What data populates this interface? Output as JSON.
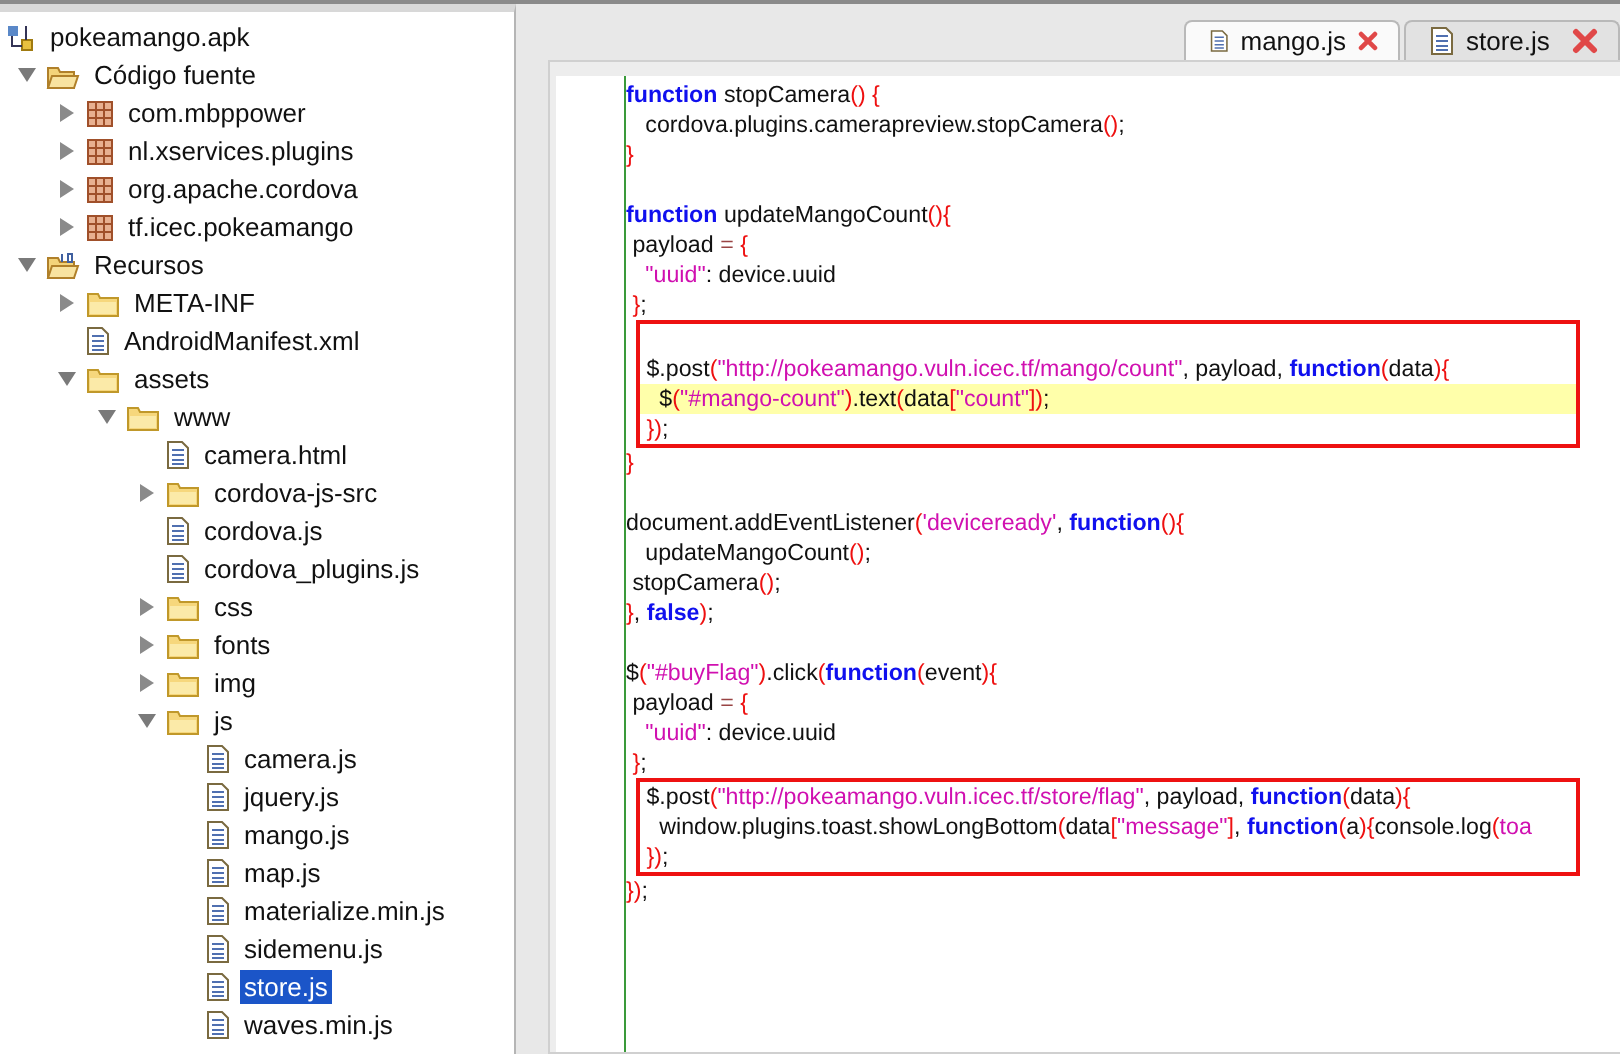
{
  "tree": [
    {
      "label": "pokeamango.apk",
      "kind": "apk",
      "children": [
        {
          "label": "Código fuente",
          "kind": "source-root",
          "expanded": true,
          "children": [
            {
              "label": "com.mbppower",
              "kind": "package",
              "expanded": false
            },
            {
              "label": "nl.xservices.plugins",
              "kind": "package",
              "expanded": false
            },
            {
              "label": "org.apache.cordova",
              "kind": "package",
              "expanded": false
            },
            {
              "label": "tf.icec.pokeamango",
              "kind": "package",
              "expanded": false
            }
          ]
        },
        {
          "label": "Recursos",
          "kind": "resource-root",
          "expanded": true,
          "children": [
            {
              "label": "META-INF",
              "kind": "folder",
              "expanded": false
            },
            {
              "label": "AndroidManifest.xml",
              "kind": "file",
              "selected": false
            },
            {
              "label": "assets",
              "kind": "folder",
              "expanded": true,
              "children": [
                {
                  "label": "www",
                  "kind": "folder",
                  "expanded": true,
                  "children": [
                    {
                      "label": "camera.html",
                      "kind": "file",
                      "selected": false
                    },
                    {
                      "label": "cordova-js-src",
                      "kind": "folder",
                      "expanded": false
                    },
                    {
                      "label": "cordova.js",
                      "kind": "file",
                      "selected": false
                    },
                    {
                      "label": "cordova_plugins.js",
                      "kind": "file",
                      "selected": false
                    },
                    {
                      "label": "css",
                      "kind": "folder",
                      "expanded": false
                    },
                    {
                      "label": "fonts",
                      "kind": "folder",
                      "expanded": false
                    },
                    {
                      "label": "img",
                      "kind": "folder",
                      "expanded": false
                    },
                    {
                      "label": "js",
                      "kind": "folder",
                      "expanded": true,
                      "children": [
                        {
                          "label": "camera.js",
                          "kind": "file",
                          "selected": false
                        },
                        {
                          "label": "jquery.js",
                          "kind": "file",
                          "selected": false
                        },
                        {
                          "label": "mango.js",
                          "kind": "file",
                          "selected": false
                        },
                        {
                          "label": "map.js",
                          "kind": "file",
                          "selected": false
                        },
                        {
                          "label": "materialize.min.js",
                          "kind": "file",
                          "selected": false
                        },
                        {
                          "label": "sidemenu.js",
                          "kind": "file",
                          "selected": false
                        },
                        {
                          "label": "store.js",
                          "kind": "file",
                          "selected": true
                        },
                        {
                          "label": "waves.min.js",
                          "kind": "file",
                          "selected": false
                        }
                      ]
                    }
                  ]
                }
              ]
            }
          ]
        }
      ]
    }
  ],
  "tabs": [
    {
      "label": "mango.js",
      "selected": true
    },
    {
      "label": "store.js",
      "selected": false
    }
  ],
  "code": [
    {
      "boxed": false,
      "lines": [
        {
          "kind": "code",
          "current": false,
          "tokens": [
            {
              "kind": "kw",
              "text": "function"
            },
            {
              "kind": "plain",
              "text": " stopCamera"
            },
            {
              "kind": "punct",
              "text": "() {"
            }
          ]
        },
        {
          "kind": "code",
          "current": false,
          "tokens": [
            {
              "kind": "plain",
              "text": "   cordova.plugins.camerapreview.stopCamera"
            },
            {
              "kind": "punct",
              "text": "()"
            },
            {
              "kind": "plain",
              "text": ";"
            }
          ]
        },
        {
          "kind": "code",
          "current": false,
          "tokens": [
            {
              "kind": "punct",
              "text": "}"
            }
          ]
        },
        {
          "kind": "blank"
        },
        {
          "kind": "code",
          "current": false,
          "tokens": [
            {
              "kind": "kw",
              "text": "function"
            },
            {
              "kind": "plain",
              "text": " updateMangoCount"
            },
            {
              "kind": "punct",
              "text": "(){"
            }
          ]
        },
        {
          "kind": "code",
          "current": false,
          "tokens": [
            {
              "kind": "plain",
              "text": " payload "
            },
            {
              "kind": "op",
              "text": "="
            },
            {
              "kind": "punct",
              "text": " {"
            }
          ]
        },
        {
          "kind": "code",
          "current": false,
          "tokens": [
            {
              "kind": "str",
              "text": "   \"uuid\""
            },
            {
              "kind": "plain",
              "text": ": device.uuid"
            }
          ]
        },
        {
          "kind": "code",
          "current": false,
          "tokens": [
            {
              "kind": "punct",
              "text": " }"
            },
            {
              "kind": "plain",
              "text": ";"
            }
          ]
        }
      ]
    },
    {
      "boxed": true,
      "lines": [
        {
          "kind": "blank"
        },
        {
          "kind": "code",
          "current": false,
          "tokens": [
            {
              "kind": "plain",
              "text": " $.post"
            },
            {
              "kind": "punct",
              "text": "("
            },
            {
              "kind": "str",
              "text": "\"http://pokeamango.vuln.icec.tf/mango/count\""
            },
            {
              "kind": "plain",
              "text": ", payload, "
            },
            {
              "kind": "kw",
              "text": "function"
            },
            {
              "kind": "punct",
              "text": "("
            },
            {
              "kind": "plain",
              "text": "data"
            },
            {
              "kind": "punct",
              "text": "){"
            }
          ]
        },
        {
          "kind": "code",
          "current": true,
          "tokens": [
            {
              "kind": "plain",
              "text": "   $"
            },
            {
              "kind": "punct",
              "text": "("
            },
            {
              "kind": "str",
              "text": "\"#mango-count\""
            },
            {
              "kind": "punct",
              "text": ")"
            },
            {
              "kind": "plain",
              "text": ".text"
            },
            {
              "kind": "punct",
              "text": "("
            },
            {
              "kind": "plain",
              "text": "data"
            },
            {
              "kind": "punct",
              "text": "["
            },
            {
              "kind": "str",
              "text": "\"count\""
            },
            {
              "kind": "punct",
              "text": "])"
            },
            {
              "kind": "plain",
              "text": ";"
            }
          ]
        },
        {
          "kind": "code",
          "current": false,
          "tokens": [
            {
              "kind": "punct",
              "text": " })"
            },
            {
              "kind": "plain",
              "text": ";"
            }
          ]
        }
      ]
    },
    {
      "boxed": false,
      "lines": [
        {
          "kind": "code",
          "current": false,
          "tokens": [
            {
              "kind": "punct",
              "text": "}"
            }
          ]
        },
        {
          "kind": "blank"
        },
        {
          "kind": "code",
          "current": false,
          "tokens": [
            {
              "kind": "plain",
              "text": "document.addEventListener"
            },
            {
              "kind": "punct",
              "text": "("
            },
            {
              "kind": "str",
              "text": "'deviceready'"
            },
            {
              "kind": "plain",
              "text": ", "
            },
            {
              "kind": "kw",
              "text": "function"
            },
            {
              "kind": "punct",
              "text": "(){"
            }
          ]
        },
        {
          "kind": "code",
          "current": false,
          "tokens": [
            {
              "kind": "plain",
              "text": "   updateMangoCount"
            },
            {
              "kind": "punct",
              "text": "()"
            },
            {
              "kind": "plain",
              "text": ";"
            }
          ]
        },
        {
          "kind": "code",
          "current": false,
          "tokens": [
            {
              "kind": "plain",
              "text": " stopCamera"
            },
            {
              "kind": "punct",
              "text": "()"
            },
            {
              "kind": "plain",
              "text": ";"
            }
          ]
        },
        {
          "kind": "code",
          "current": false,
          "tokens": [
            {
              "kind": "punct",
              "text": "}"
            },
            {
              "kind": "plain",
              "text": ", "
            },
            {
              "kind": "kw",
              "text": "false"
            },
            {
              "kind": "punct",
              "text": ")"
            },
            {
              "kind": "plain",
              "text": ";"
            }
          ]
        },
        {
          "kind": "blank"
        },
        {
          "kind": "code",
          "current": false,
          "tokens": [
            {
              "kind": "plain",
              "text": "$"
            },
            {
              "kind": "punct",
              "text": "("
            },
            {
              "kind": "str",
              "text": "\"#buyFlag\""
            },
            {
              "kind": "punct",
              "text": ")"
            },
            {
              "kind": "plain",
              "text": ".click"
            },
            {
              "kind": "punct",
              "text": "("
            },
            {
              "kind": "kw",
              "text": "function"
            },
            {
              "kind": "punct",
              "text": "("
            },
            {
              "kind": "plain",
              "text": "event"
            },
            {
              "kind": "punct",
              "text": "){"
            }
          ]
        },
        {
          "kind": "code",
          "current": false,
          "tokens": [
            {
              "kind": "plain",
              "text": " payload "
            },
            {
              "kind": "op",
              "text": "="
            },
            {
              "kind": "punct",
              "text": " {"
            }
          ]
        },
        {
          "kind": "code",
          "current": false,
          "tokens": [
            {
              "kind": "str",
              "text": "   \"uuid\""
            },
            {
              "kind": "plain",
              "text": ": device.uuid"
            }
          ]
        },
        {
          "kind": "code",
          "current": false,
          "tokens": [
            {
              "kind": "punct",
              "text": " }"
            },
            {
              "kind": "plain",
              "text": ";"
            }
          ]
        }
      ]
    },
    {
      "boxed": true,
      "lines": [
        {
          "kind": "code",
          "current": false,
          "tokens": [
            {
              "kind": "plain",
              "text": " $.post"
            },
            {
              "kind": "punct",
              "text": "("
            },
            {
              "kind": "str",
              "text": "\"http://pokeamango.vuln.icec.tf/store/flag\""
            },
            {
              "kind": "plain",
              "text": ", payload, "
            },
            {
              "kind": "kw",
              "text": "function"
            },
            {
              "kind": "punct",
              "text": "("
            },
            {
              "kind": "plain",
              "text": "data"
            },
            {
              "kind": "punct",
              "text": "){"
            }
          ]
        },
        {
          "kind": "code",
          "current": false,
          "tokens": [
            {
              "kind": "plain",
              "text": "   window.plugins.toast.showLongBottom"
            },
            {
              "kind": "punct",
              "text": "("
            },
            {
              "kind": "plain",
              "text": "data"
            },
            {
              "kind": "punct",
              "text": "["
            },
            {
              "kind": "str",
              "text": "\"message\""
            },
            {
              "kind": "punct",
              "text": "]"
            },
            {
              "kind": "plain",
              "text": ", "
            },
            {
              "kind": "kw",
              "text": "function"
            },
            {
              "kind": "punct",
              "text": "("
            },
            {
              "kind": "plain",
              "text": "a"
            },
            {
              "kind": "punct",
              "text": "){"
            },
            {
              "kind": "plain",
              "text": "console.log"
            },
            {
              "kind": "punct",
              "text": "("
            },
            {
              "kind": "str",
              "text": "toa"
            }
          ]
        },
        {
          "kind": "code",
          "current": false,
          "tokens": [
            {
              "kind": "punct",
              "text": " })"
            },
            {
              "kind": "plain",
              "text": ";"
            }
          ]
        }
      ]
    },
    {
      "boxed": false,
      "lines": [
        {
          "kind": "code",
          "current": false,
          "tokens": [
            {
              "kind": "punct",
              "text": "})"
            },
            {
              "kind": "plain",
              "text": ";"
            }
          ]
        }
      ]
    }
  ]
}
